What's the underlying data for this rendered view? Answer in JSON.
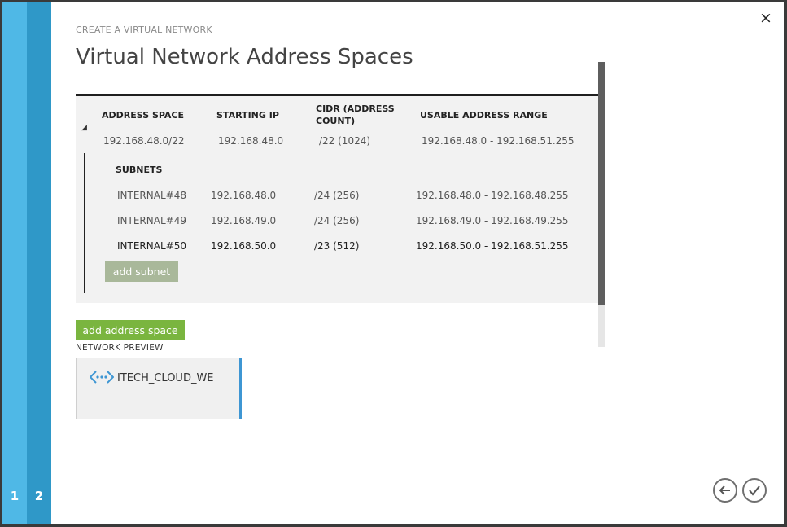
{
  "wizard": {
    "title": "CREATE A VIRTUAL NETWORK",
    "page_title": "Virtual Network Address Spaces",
    "steps": [
      "1",
      "2"
    ],
    "current_step": 2
  },
  "address_table": {
    "headers": {
      "address_space": "ADDRESS SPACE",
      "starting_ip": "STARTING IP",
      "cidr_line1": "CIDR (ADDRESS",
      "cidr_line2": "COUNT)",
      "usable_range": "USABLE ADDRESS RANGE"
    },
    "space": {
      "address_space": "192.168.48.0/22",
      "starting_ip": "192.168.48.0",
      "cidr": "/22 (1024)",
      "usable_range": "192.168.48.0 - 192.168.51.255"
    },
    "subnets_label": "SUBNETS",
    "subnets": [
      {
        "name": "INTERNAL#48",
        "starting_ip": "192.168.48.0",
        "cidr": "/24 (256)",
        "usable_range": "192.168.48.0 - 192.168.48.255"
      },
      {
        "name": "INTERNAL#49",
        "starting_ip": "192.168.49.0",
        "cidr": "/24 (256)",
        "usable_range": "192.168.49.0 - 192.168.49.255"
      },
      {
        "name": "INTERNAL#50",
        "starting_ip": "192.168.50.0",
        "cidr": "/23 (512)",
        "usable_range": "192.168.50.0 - 192.168.51.255"
      }
    ],
    "add_subnet_label": "add subnet"
  },
  "add_address_space_label": "add address space",
  "network_preview": {
    "label": "NETWORK PREVIEW",
    "network_name": "ITECH_CLOUD_WE",
    "icon": "virtual-network-icon"
  },
  "nav": {
    "close_glyph": "×",
    "back_icon": "back-arrow-icon",
    "finish_icon": "checkmark-icon"
  },
  "colors": {
    "step1": "#4fb8e6",
    "step2": "#2f98c8",
    "green_button": "#7ab53f",
    "disabled_green": "#a9b89a",
    "accent_blue": "#3e96d3"
  }
}
